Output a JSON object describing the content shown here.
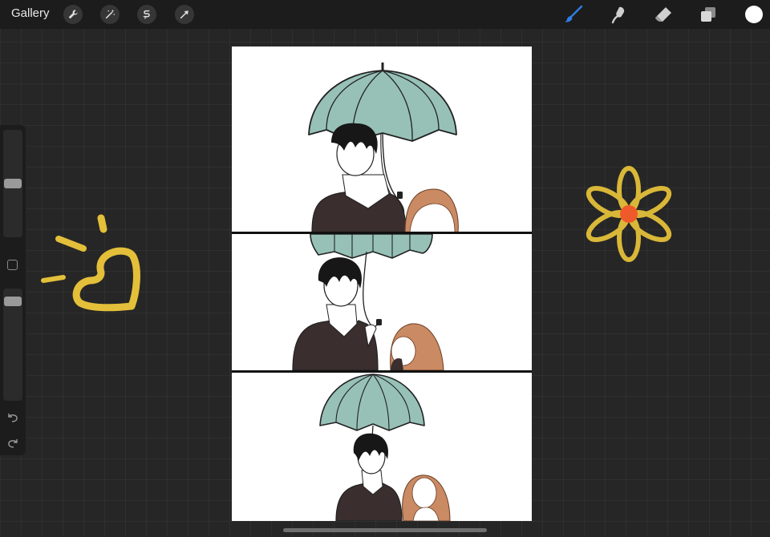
{
  "toolbar": {
    "gallery_label": "Gallery",
    "left_tools": [
      "wrench-icon",
      "magic-wand-icon",
      "selection-icon",
      "transform-icon"
    ],
    "right_tools": [
      "brush-icon",
      "smudge-icon",
      "eraser-icon",
      "layers-icon"
    ],
    "active_tool": "brush-icon",
    "current_color": "#ffffff"
  },
  "sidebar": {
    "size_slider_level": 0.5,
    "opacity_slider_level": 0.05,
    "icons": [
      "modify-square-icon",
      "undo-icon",
      "redo-icon"
    ]
  },
  "colors": {
    "background": "#262626",
    "toolbar": "#1c1c1c",
    "accent_blue": "#2f7de1",
    "umbrella": "#97c1b7",
    "shirt": "#3a2e2e",
    "girl_hair": "#c98a64",
    "doodle_yellow": "#e3bf3a",
    "flower_center": "#ef5a2a"
  },
  "canvas": {
    "panels": 3,
    "background": "#ffffff"
  }
}
